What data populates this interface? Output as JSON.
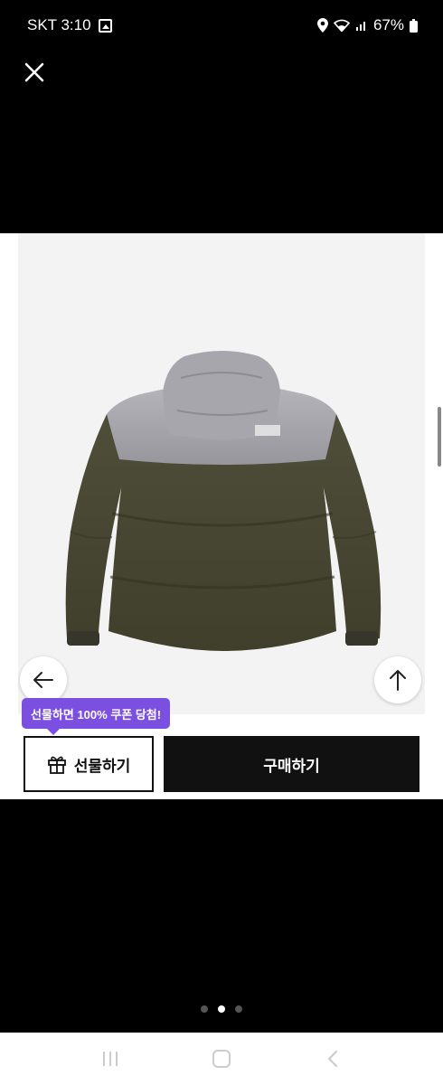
{
  "status_bar": {
    "carrier_time": "SKT 3:10",
    "battery": "67%",
    "icons": [
      "gallery-icon",
      "location-icon",
      "wifi-icon",
      "signal-icon",
      "battery-icon"
    ]
  },
  "toolbar": {
    "close_icon": "close-icon"
  },
  "product": {
    "image_description_icon": "jacket-image",
    "colors": {
      "body": "#4a4a35",
      "yoke": "#a7a7ad",
      "background": "#f3f3f3"
    }
  },
  "actions": {
    "back_icon": "arrow-left-icon",
    "top_icon": "arrow-up-icon",
    "tooltip": "선물하면 100% 쿠폰 당첨!",
    "gift_label": "선물하기",
    "buy_label": "구매하기",
    "accent_color": "#7b4fe0"
  },
  "pagination": {
    "total": 3,
    "active_index": 1
  },
  "navigation": {
    "buttons": [
      "recent-apps-icon",
      "home-icon",
      "back-icon"
    ]
  }
}
